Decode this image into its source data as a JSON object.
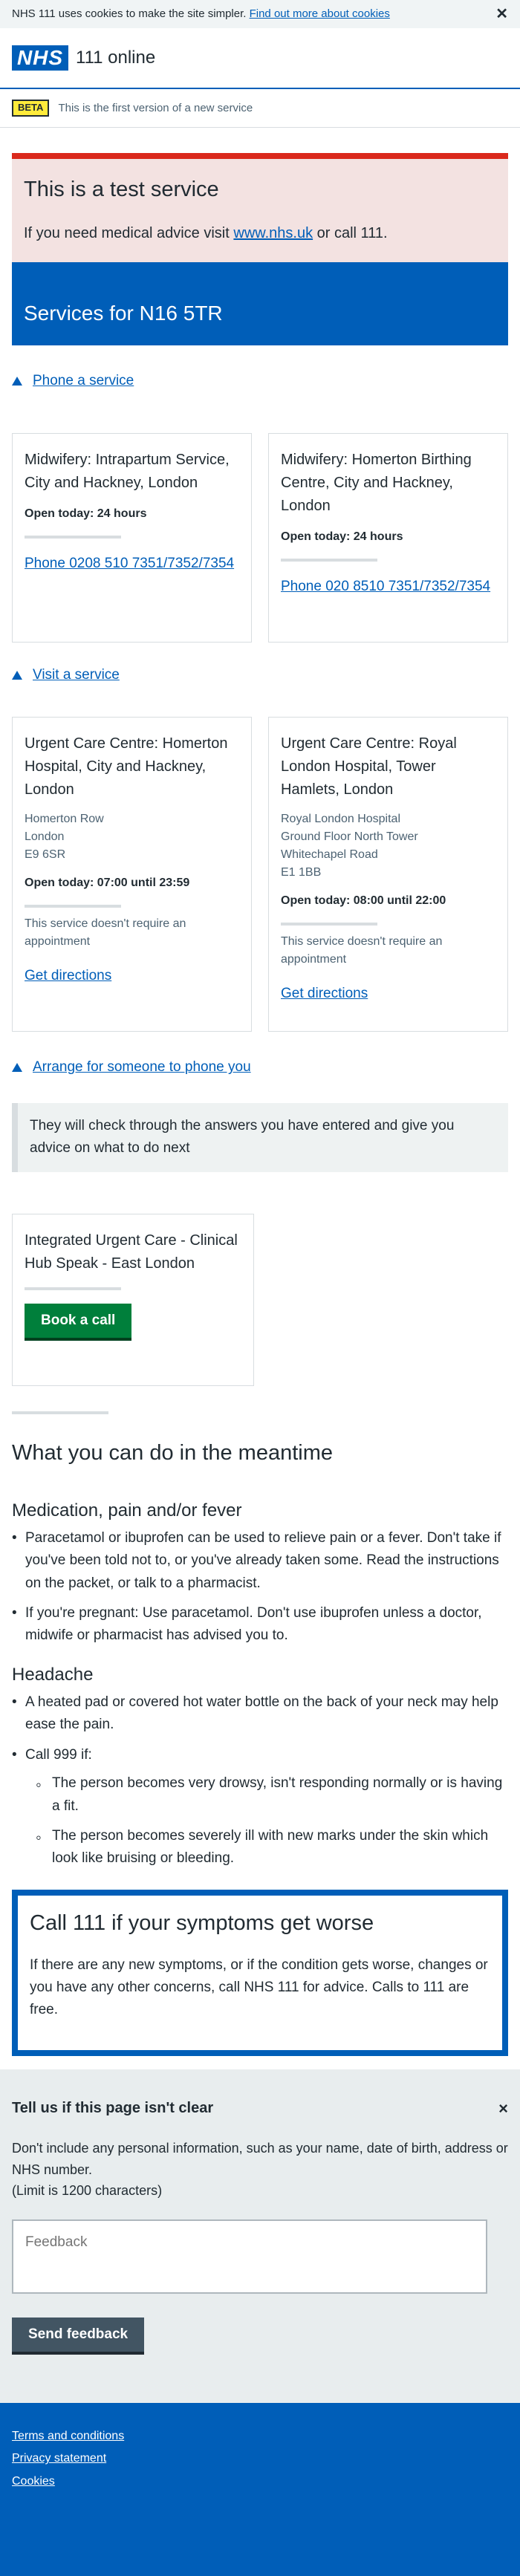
{
  "cookie": {
    "text": "NHS 111 uses cookies to make the site simpler.",
    "link": "Find out more about cookies",
    "close": "✕"
  },
  "header": {
    "logo": "NHS",
    "service": "111 online"
  },
  "beta": {
    "tag": "BETA",
    "text": "This is the first version of a new service"
  },
  "test_banner": {
    "title": "This is a test service",
    "text_before": "If you need medical advice visit ",
    "link": "www.nhs.uk",
    "text_after": " or call 111."
  },
  "services_title": "Services for N16 5TR",
  "phone_section": {
    "toggle": "Phone a service",
    "cards": [
      {
        "name": "Midwifery: Intrapartum Service, City and Hackney, London",
        "open": "Open today: 24 hours",
        "phone": "Phone 0208 510 7351/7352/7354"
      },
      {
        "name": "Midwifery: Homerton Birthing Centre, City and Hackney, London",
        "open": "Open today: 24 hours",
        "phone": "Phone 020 8510 7351/7352/7354"
      }
    ]
  },
  "visit_section": {
    "toggle": "Visit a service",
    "cards": [
      {
        "name": "Urgent Care Centre: Homerton Hospital, City and Hackney, London",
        "address": [
          "Homerton Row",
          "London",
          "E9 6SR"
        ],
        "open": "Open today: 07:00 until 23:59",
        "note": "This service doesn't require an appointment",
        "directions": "Get directions"
      },
      {
        "name": "Urgent Care Centre: Royal London Hospital, Tower Hamlets, London",
        "address": [
          "Royal London Hospital",
          "Ground Floor North Tower",
          "Whitechapel Road",
          "E1 1BB"
        ],
        "open": "Open today: 08:00 until 22:00",
        "note": "This service doesn't require an appointment",
        "directions": "Get directions"
      }
    ]
  },
  "callback_section": {
    "toggle": "Arrange for someone to phone you",
    "inset": "They will check through the answers you have entered and give you advice on what to do next",
    "card": {
      "name": "Integrated Urgent Care - Clinical Hub Speak - East London",
      "button": "Book a call"
    }
  },
  "meantime": {
    "title": "What you can do in the meantime",
    "medication": {
      "title": "Medication, pain and/or fever",
      "items": [
        "Paracetamol or ibuprofen can be used to relieve pain or a fever. Don't take if you've been told not to, or you've already taken some. Read the instructions on the packet, or talk to a pharmacist.",
        "If you're pregnant: Use paracetamol. Don't use ibuprofen unless a doctor, midwife or pharmacist has advised you to."
      ]
    },
    "headache": {
      "title": "Headache",
      "item1": "A heated pad or covered hot water bottle on the back of your neck may help ease the pain.",
      "item2": "Call 999 if:",
      "subitems": [
        "The person becomes very drowsy, isn't responding normally or is having a fit.",
        "The person becomes severely ill with new marks under the skin which look like bruising or bleeding."
      ]
    }
  },
  "callout": {
    "title": "Call 111 if your symptoms get worse",
    "text": "If there are any new symptoms, or if the condition gets worse, changes or you have any other concerns, call NHS 111 for advice. Calls to 111 are free."
  },
  "feedback": {
    "title": "Tell us if this page isn't clear",
    "close": "×",
    "text": "Don't include any personal information, such as your name, date of birth, address or NHS number.",
    "limit": "(Limit is 1200 characters)",
    "placeholder": "Feedback",
    "button": "Send feedback"
  },
  "footer": {
    "links": [
      "Terms and conditions",
      "Privacy statement",
      "Cookies"
    ]
  },
  "colors": {
    "nhs_blue": "#005eb8",
    "green": "#007f3b",
    "red": "#da291c",
    "beta_yellow": "#ffeb3b"
  }
}
